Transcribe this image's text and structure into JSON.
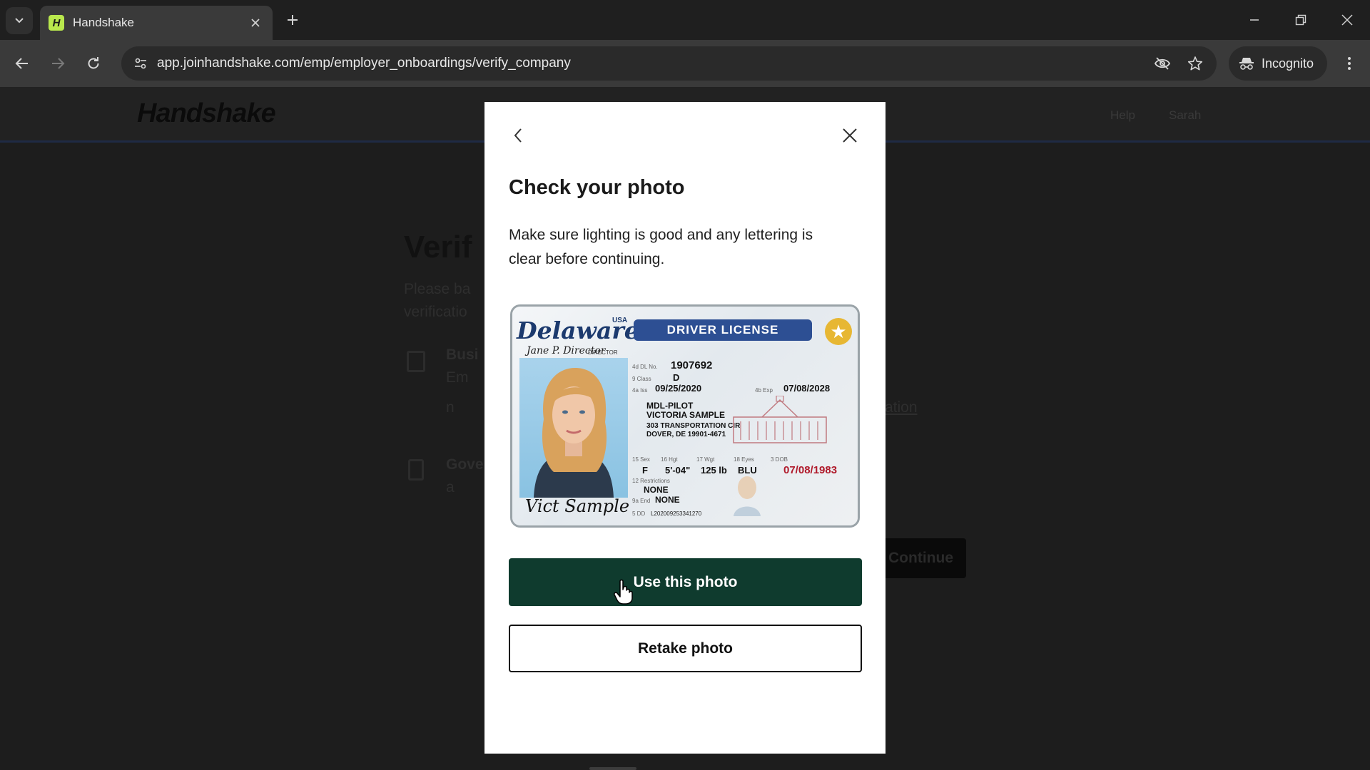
{
  "browser": {
    "tab_title": "Handshake",
    "tab_favicon_letter": "H",
    "url": "app.joinhandshake.com/emp/employer_onboardings/verify_company",
    "incognito_label": "Incognito"
  },
  "site": {
    "logo": "Handshake",
    "header_links": [
      "Help",
      "Sarah"
    ]
  },
  "background_page": {
    "title": "Verif",
    "lines": [
      "Please ba",
      "verificatio",
      "Busi",
      "Em",
      "n",
      "ation",
      "Gove",
      "a"
    ],
    "continue_label": "Continue"
  },
  "modal": {
    "title": "Check your photo",
    "description": "Make sure lighting is good and any lettering is clear before continuing.",
    "primary_button": "Use this photo",
    "secondary_button": "Retake photo"
  },
  "license": {
    "state": "Delaware",
    "country": "USA",
    "banner": "DRIVER LICENSE",
    "director_signature": "Jane P. Director",
    "director_label": "DIRECTOR",
    "fields": {
      "dl_no_label": "4d DL No.",
      "dl_no": "1907692",
      "class_label": "9 Class",
      "class": "D",
      "issued_label": "4a Iss",
      "issued": "09/25/2020",
      "expires_label": "4b Exp",
      "expires": "07/08/2028",
      "name_line1": "MDL-PILOT",
      "name_line2": "VICTORIA SAMPLE",
      "address_line1": "303 TRANSPORTATION CIR",
      "address_line2": "DOVER, DE 19901-4671",
      "sex_label": "15 Sex",
      "sex": "F",
      "hgt_label": "16 Hgt",
      "hgt": "5'-04\"",
      "wgt_label": "17 Wgt",
      "wgt": "125 lb",
      "eyes_label": "18 Eyes",
      "eyes": "BLU",
      "dob_label": "3 DOB",
      "dob": "07/08/1983",
      "restrictions_label": "12 Restrictions",
      "restrictions": "NONE",
      "end_label": "9a End",
      "end": "NONE",
      "dd_label": "5 DD",
      "dd": "L202009253341270"
    },
    "signature": "Vict Sample"
  },
  "colors": {
    "primary_button": "#0f3b2e",
    "license_banner": "#2d4f93",
    "dob_red": "#b01a2b",
    "tab_favicon": "#b9e84d"
  }
}
